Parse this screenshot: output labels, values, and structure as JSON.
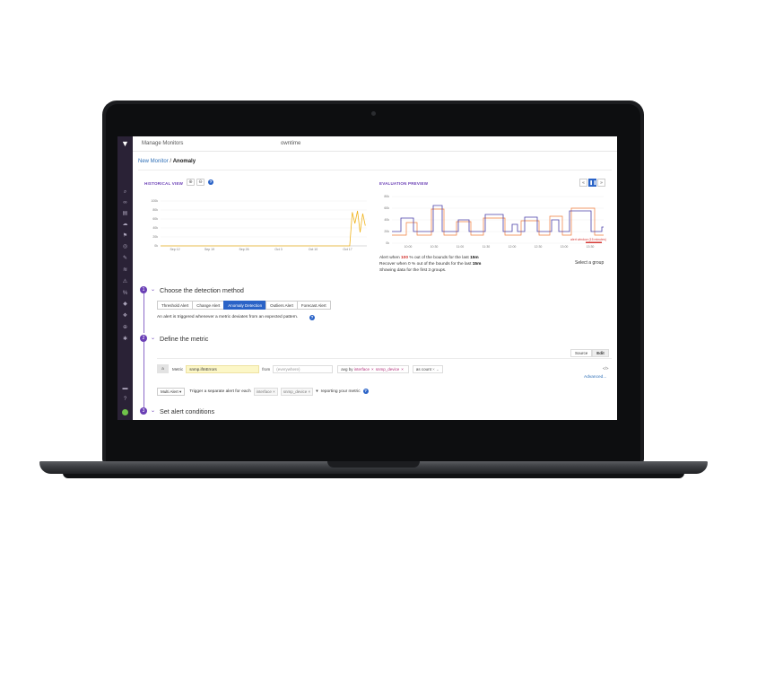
{
  "window": {
    "tabs": [
      "Manage Monitors",
      "owntime"
    ]
  },
  "breadcrumb": {
    "parent": "New Monitor",
    "separator": " / ",
    "current": "Anomaly"
  },
  "historical": {
    "title": "HISTORICAL VIEW",
    "zoom_in_icon": "zoom-in-icon",
    "zoom_out_icon": "zoom-out-icon",
    "help": "?",
    "y_ticks": [
      "100k",
      "80k",
      "60k",
      "40k",
      "20k",
      "0k"
    ],
    "x_ticks": [
      "Sep 12",
      "Sep 19",
      "Sep 26",
      "Oct 3",
      "Oct 10",
      "Oct 17"
    ],
    "line_color": "#f0b41e"
  },
  "chart_data": {
    "type": "line",
    "title": "HISTORICAL VIEW",
    "categories": [
      "Sep 12",
      "Sep 19",
      "Sep 26",
      "Oct 3",
      "Oct 10",
      "Oct 17"
    ],
    "series": [
      {
        "values_tail": [
          0,
          0,
          75000,
          50000,
          78000,
          30000,
          72000,
          45000
        ],
        "color": "#f0b41e"
      }
    ],
    "ylim": [
      0,
      100000
    ]
  },
  "evaluation": {
    "title": "EVALUATION PREVIEW",
    "y_ticks": [
      "80k",
      "60k",
      "40k",
      "20k",
      "0k"
    ],
    "x_ticks": [
      "10:00",
      "10:30",
      "11:00",
      "11:30",
      "12:00",
      "12:30",
      "13:00",
      "13:30"
    ],
    "window_label": "alert window (15 minutes)",
    "controls": [
      "«",
      "❚❚",
      "»"
    ],
    "alert_text": {
      "prefix": "Alert when ",
      "pct": "100",
      "mid": " % out of the bounds for the last ",
      "window": "15m"
    },
    "recover_text": {
      "prefix": "Recover when ",
      "pct": "0",
      "mid": " % out of the bounds for the last ",
      "window": "15m"
    },
    "showing_text": "Showing data for the first 3 groups.",
    "select_group": "Select a group",
    "colors": {
      "series_a": "#4a3fa8",
      "series_b": "#f07c3a",
      "bounds": "#d63a36"
    }
  },
  "step1": {
    "num": "1",
    "title": "Choose the detection method",
    "tabs": [
      "Threshold Alert",
      "Change Alert",
      "Anomaly Detection",
      "Outliers Alert",
      "Forecast Alert"
    ],
    "active_tab": "Anomaly Detection",
    "description": "An alert is triggered whenever a metric deviates from an expected pattern."
  },
  "step2": {
    "num": "2",
    "title": "Define the metric",
    "source_label": "Source",
    "edit_label": "Edit",
    "query_letter": "a",
    "metric_label": "Metric",
    "metric_value": "snmp.ifInErrors",
    "from_label": "from",
    "from_placeholder": "(everywhere)",
    "avg_by_label": "avg by",
    "avg_by_tags": [
      "interface",
      "snmp_device"
    ],
    "as_label": "as",
    "as_value": "count",
    "advanced": "Advanced...",
    "code_icon": "</>",
    "multi_alert": "Multi Alert ▾",
    "multi_text": "Trigger a separate alert for each",
    "multi_tags": [
      "interface",
      "snmp_device"
    ],
    "reporting_text": "reporting your metric"
  },
  "step3": {
    "num": "3",
    "title": "Set alert conditions"
  },
  "nav_icons": [
    "search-icon",
    "binoculars-icon",
    "dashboard-icon",
    "infrastructure-icon",
    "monitors-icon",
    "apm-icon",
    "notebook-icon",
    "logs-icon",
    "security-icon",
    "synthetics-icon",
    "rum-icon",
    "watchdog-icon",
    "integrations-icon",
    "settings-icon"
  ]
}
